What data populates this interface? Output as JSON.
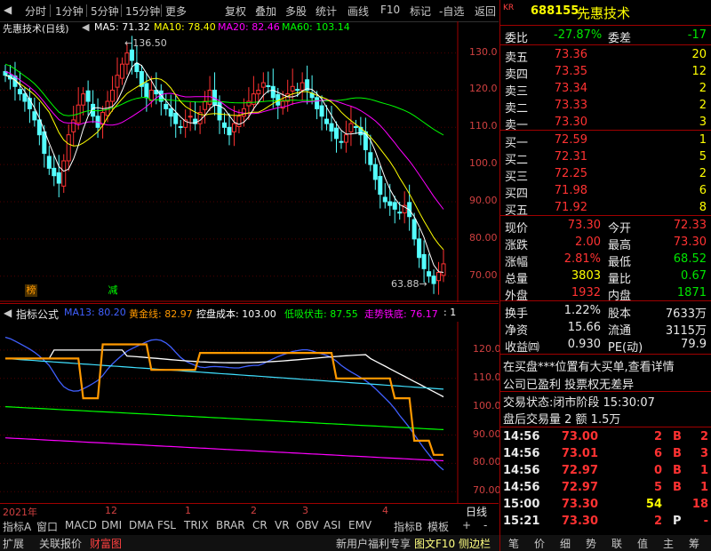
{
  "toolbar": {
    "items": [
      "分时",
      "1分钟",
      "5分钟",
      "15分钟",
      "更多"
    ],
    "right_items": [
      "复权",
      "叠加",
      "多股",
      "统计",
      "画线",
      "F10",
      "标记",
      "-自选",
      "返回"
    ]
  },
  "main": {
    "title": "先惠技术(日线)",
    "ma": [
      {
        "label": "MA5: 71.32",
        "color": "#ffffff"
      },
      {
        "label": "MA10: 78.40",
        "color": "#ffff00"
      },
      {
        "label": "MA20: 82.46",
        "color": "#ff00ff"
      },
      {
        "label": "MA60: 103.14",
        "color": "#00ff00"
      }
    ],
    "high_label": "136.50",
    "low_label": "63.88",
    "tag1": "榜",
    "tag2": "减"
  },
  "indicator": {
    "title": "指标公式",
    "items": [
      {
        "label": "MA13: 80.20",
        "color": "#4060ff"
      },
      {
        "label": "黄金线: 82.97",
        "color": "#ff9900"
      },
      {
        "label": "控盘成本: 103.00",
        "color": "#ffffff"
      },
      {
        "label": "低吸伏击: 87.55",
        "color": "#00ff00"
      },
      {
        "label": "走势铁底: 76.17",
        "color": "#ff00ff"
      },
      {
        "label": ": 1",
        "color": "#ffffff"
      }
    ]
  },
  "xaxis": {
    "year": "2021年",
    "months": [
      "12",
      "1",
      "2",
      "3",
      "4"
    ],
    "period": "日线"
  },
  "bottom_tabs": [
    "指标A",
    "窗口",
    "MACD",
    "DMI",
    "DMA",
    "FSL",
    "TRIX",
    "BRAR",
    "CR",
    "VR",
    "OBV",
    "ASI",
    "EMV",
    "指标B",
    "模板",
    "+",
    "-"
  ],
  "bottom_bar": {
    "left": [
      "扩展",
      "关联报价",
      "财富图"
    ],
    "center": [
      "新用户福利专享",
      "图文F10",
      "侧边栏"
    ],
    "right": [
      "笔",
      "价",
      "细",
      "势",
      "联",
      "值",
      "主",
      "筹"
    ]
  },
  "quote": {
    "kr": "KR",
    "code": "688155",
    "name": "先惠技术",
    "weibi_label": "委比",
    "weibi": "-27.87%",
    "weicha_label": "委差",
    "weicha": "-17",
    "asks": [
      {
        "label": "卖五",
        "price": "73.36",
        "vol": "20"
      },
      {
        "label": "卖四",
        "price": "73.35",
        "vol": "12"
      },
      {
        "label": "卖三",
        "price": "73.34",
        "vol": "2"
      },
      {
        "label": "卖二",
        "price": "73.33",
        "vol": "2"
      },
      {
        "label": "卖一",
        "price": "73.30",
        "vol": "3"
      }
    ],
    "bids": [
      {
        "label": "买一",
        "price": "72.59",
        "vol": "1"
      },
      {
        "label": "买二",
        "price": "72.31",
        "vol": "5"
      },
      {
        "label": "买三",
        "price": "72.25",
        "vol": "2"
      },
      {
        "label": "买四",
        "price": "71.98",
        "vol": "6"
      },
      {
        "label": "买五",
        "price": "71.92",
        "vol": "8"
      }
    ],
    "stats1": [
      {
        "l1": "现价",
        "v1": "73.30",
        "c1": "red",
        "l2": "今开",
        "v2": "72.33",
        "c2": "red"
      },
      {
        "l1": "涨跌",
        "v1": "2.00",
        "c1": "red",
        "l2": "最高",
        "v2": "73.30",
        "c2": "red"
      },
      {
        "l1": "涨幅",
        "v1": "2.81%",
        "c1": "red",
        "l2": "最低",
        "v2": "68.52",
        "c2": "grn"
      },
      {
        "l1": "总量",
        "v1": "3803",
        "c1": "yel",
        "l2": "量比",
        "v2": "0.67",
        "c2": "grn"
      },
      {
        "l1": "外盘",
        "v1": "1932",
        "c1": "red",
        "l2": "内盘",
        "v2": "1871",
        "c2": "grn"
      }
    ],
    "stats2": [
      {
        "l1": "换手",
        "v1": "1.22%",
        "l2": "股本",
        "v2": "7633万"
      },
      {
        "l1": "净资",
        "v1": "15.66",
        "l2": "流通",
        "v2": "3115万"
      },
      {
        "l1": "收益㈣",
        "v1": "0.930",
        "l2": "PE(动)",
        "v2": "79.9"
      }
    ],
    "news1": "在买盘***位置有大买单,查看详情",
    "news2": "公司已盈利 投票权无差异",
    "status": "交易状态:闭市阶段 15:30:07",
    "after": "盘后交易量 2 额 1.5万",
    "ticks": [
      {
        "t": "14:56",
        "p": "73.00",
        "v": "2",
        "s": "B",
        "n": "2"
      },
      {
        "t": "14:56",
        "p": "73.01",
        "v": "6",
        "s": "B",
        "n": "3"
      },
      {
        "t": "14:56",
        "p": "72.97",
        "v": "0",
        "s": "B",
        "n": "1"
      },
      {
        "t": "14:56",
        "p": "72.97",
        "v": "5",
        "s": "B",
        "n": "1"
      },
      {
        "t": "15:00",
        "p": "73.30",
        "v": "54",
        "s": "",
        "n": "18"
      },
      {
        "t": "15:21",
        "p": "73.30",
        "v": "2",
        "s": "P",
        "n": "-"
      }
    ]
  },
  "chart_data": [
    {
      "type": "candlestick",
      "title": "先惠技术(日线)",
      "ylim": [
        63,
        137
      ],
      "yticks": [
        "130.0",
        "120.0",
        "110.0",
        "100.0",
        "90.00",
        "80.00",
        "70.00"
      ],
      "high": 136.5,
      "low": 63.88,
      "close": [
        124,
        123,
        121,
        119,
        117,
        115,
        112,
        108,
        103,
        99,
        97,
        95,
        101,
        108,
        112,
        116,
        119,
        117,
        113,
        110,
        114,
        117,
        120,
        124,
        127,
        130,
        128,
        125,
        121,
        118,
        120,
        119,
        117,
        115,
        113,
        111,
        110,
        112,
        113,
        111,
        114,
        117,
        120,
        116,
        112,
        110,
        108,
        111,
        113,
        115,
        117,
        119,
        120,
        122,
        121,
        118,
        116,
        117,
        119,
        121,
        120,
        122,
        120,
        118,
        115,
        113,
        111,
        109,
        107,
        106,
        108,
        111,
        110,
        108,
        104,
        100,
        96,
        92,
        90,
        89,
        88,
        87,
        89,
        86,
        80,
        75,
        72,
        70,
        68,
        71,
        73.3
      ],
      "ma5": [
        124,
        123.5,
        122.7,
        121.3,
        119.6,
        117.5,
        115.2,
        112.5,
        109.2,
        105.8,
        102.6,
        99.5,
        98.2,
        98.8,
        101.5,
        105.2,
        109.5,
        113,
        115.2,
        115.3,
        115,
        115.2,
        115.6,
        117.1,
        119.9,
        123.2,
        126.2,
        127.4,
        126.6,
        124.5,
        122.6,
        120.2,
        118.6,
        117.2,
        115.6,
        114.2,
        112.8,
        111.6,
        111.2,
        111.2,
        111.9,
        113.2,
        115,
        116,
        115.8,
        115,
        113.2,
        111.4,
        110.8,
        111.4,
        112.8,
        115,
        116.8,
        118.6,
        119.8,
        120,
        119.4,
        118.8,
        118.2,
        118.2,
        118.6,
        119.8,
        120.4,
        120.2,
        119,
        117.6,
        115.4,
        113.2,
        111,
        109.2,
        108.2,
        108.2,
        108.4,
        108.6,
        108.2,
        106.6,
        103.6,
        100,
        96.4,
        93.4,
        91,
        89.2,
        88.6,
        87.8,
        86,
        83.4,
        80.4,
        76.6,
        73,
        71.2,
        71
      ]
    },
    {
      "type": "line",
      "title": "指标公式",
      "ylim": [
        66,
        130
      ],
      "yticks": [
        "120.0",
        "110.0",
        "100.0",
        "90.00",
        "80.00",
        "70.00"
      ],
      "series": [
        {
          "name": "MA13",
          "values": [
            80.2
          ]
        },
        {
          "name": "黄金线",
          "values": [
            82.97
          ]
        },
        {
          "name": "控盘成本",
          "values": [
            103.0
          ]
        },
        {
          "name": "低吸伏击",
          "values": [
            87.55
          ]
        },
        {
          "name": "走势铁底",
          "values": [
            76.17
          ]
        }
      ]
    }
  ]
}
